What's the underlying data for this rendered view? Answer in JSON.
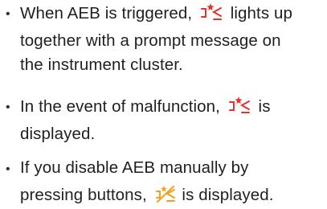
{
  "items": [
    {
      "line1_before": "When AEB is triggered,",
      "line1_after": "lights up",
      "line2": "together with a prompt message on",
      "line3": "the instrument cluster.",
      "icon": "aeb-warning-icon"
    },
    {
      "line1_before": "In the event of malfunction,",
      "line1_after": "is",
      "line2": "displayed.",
      "icon": "aeb-warning-icon"
    },
    {
      "line1_before": "If you disable AEB manually by",
      "line2_before": "pressing buttons,",
      "line2_after": "is displayed.",
      "icon": "aeb-off-icon"
    }
  ],
  "colors": {
    "text": "#1f1f1f",
    "icon_red": "#e8312a",
    "icon_amber": "#f2a019"
  },
  "bullet": "•"
}
